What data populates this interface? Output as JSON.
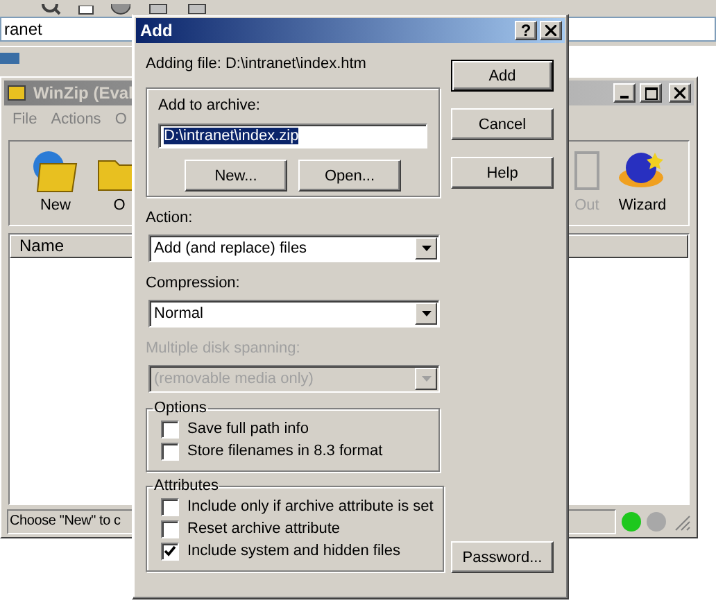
{
  "browser": {
    "address": "ranet"
  },
  "winzip": {
    "title": "WinZip (Eval",
    "menu": [
      "File",
      "Actions",
      "O"
    ],
    "toolbar_left": [
      {
        "label": "New",
        "disabled": false
      },
      {
        "label": "O",
        "disabled": false
      }
    ],
    "toolbar_right": [
      {
        "label": "Out",
        "disabled": true
      },
      {
        "label": "Wizard",
        "disabled": false
      }
    ],
    "columns": [
      "Name"
    ],
    "status": "Choose \"New\" to c",
    "lights": [
      {
        "color": "#1ec81e"
      },
      {
        "color": "#a8a8a8"
      }
    ]
  },
  "dialog": {
    "title": "Add",
    "help_glyph": "?",
    "adding": "Adding file: D:\\intranet\\index.htm",
    "archive": {
      "label": "Add to archive:",
      "value": "D:\\intranet\\index.zip",
      "text_selected": true,
      "buttons": [
        "New...",
        "Open..."
      ]
    },
    "side_buttons": [
      {
        "label": "Add",
        "default": true
      },
      {
        "label": "Cancel",
        "default": false
      },
      {
        "label": "Help",
        "default": false
      }
    ],
    "dropdowns": [
      {
        "label": "Action:",
        "value": "Add (and replace) files",
        "disabled": false
      },
      {
        "label": "Compression:",
        "value": "Normal",
        "disabled": false
      },
      {
        "label": "Multiple disk spanning:",
        "value": "(removable media only)",
        "disabled": true
      }
    ],
    "groups": [
      {
        "title": "Options",
        "items": [
          {
            "label": "Save full path info",
            "checked": false
          },
          {
            "label": "Store filenames in 8.3 format",
            "checked": false
          }
        ]
      },
      {
        "title": "Attributes",
        "items": [
          {
            "label": "Include only if archive attribute is set",
            "checked": false
          },
          {
            "label": "Reset archive attribute",
            "checked": false
          },
          {
            "label": "Include system and hidden files",
            "checked": true
          }
        ]
      }
    ],
    "password_button": "Password..."
  }
}
